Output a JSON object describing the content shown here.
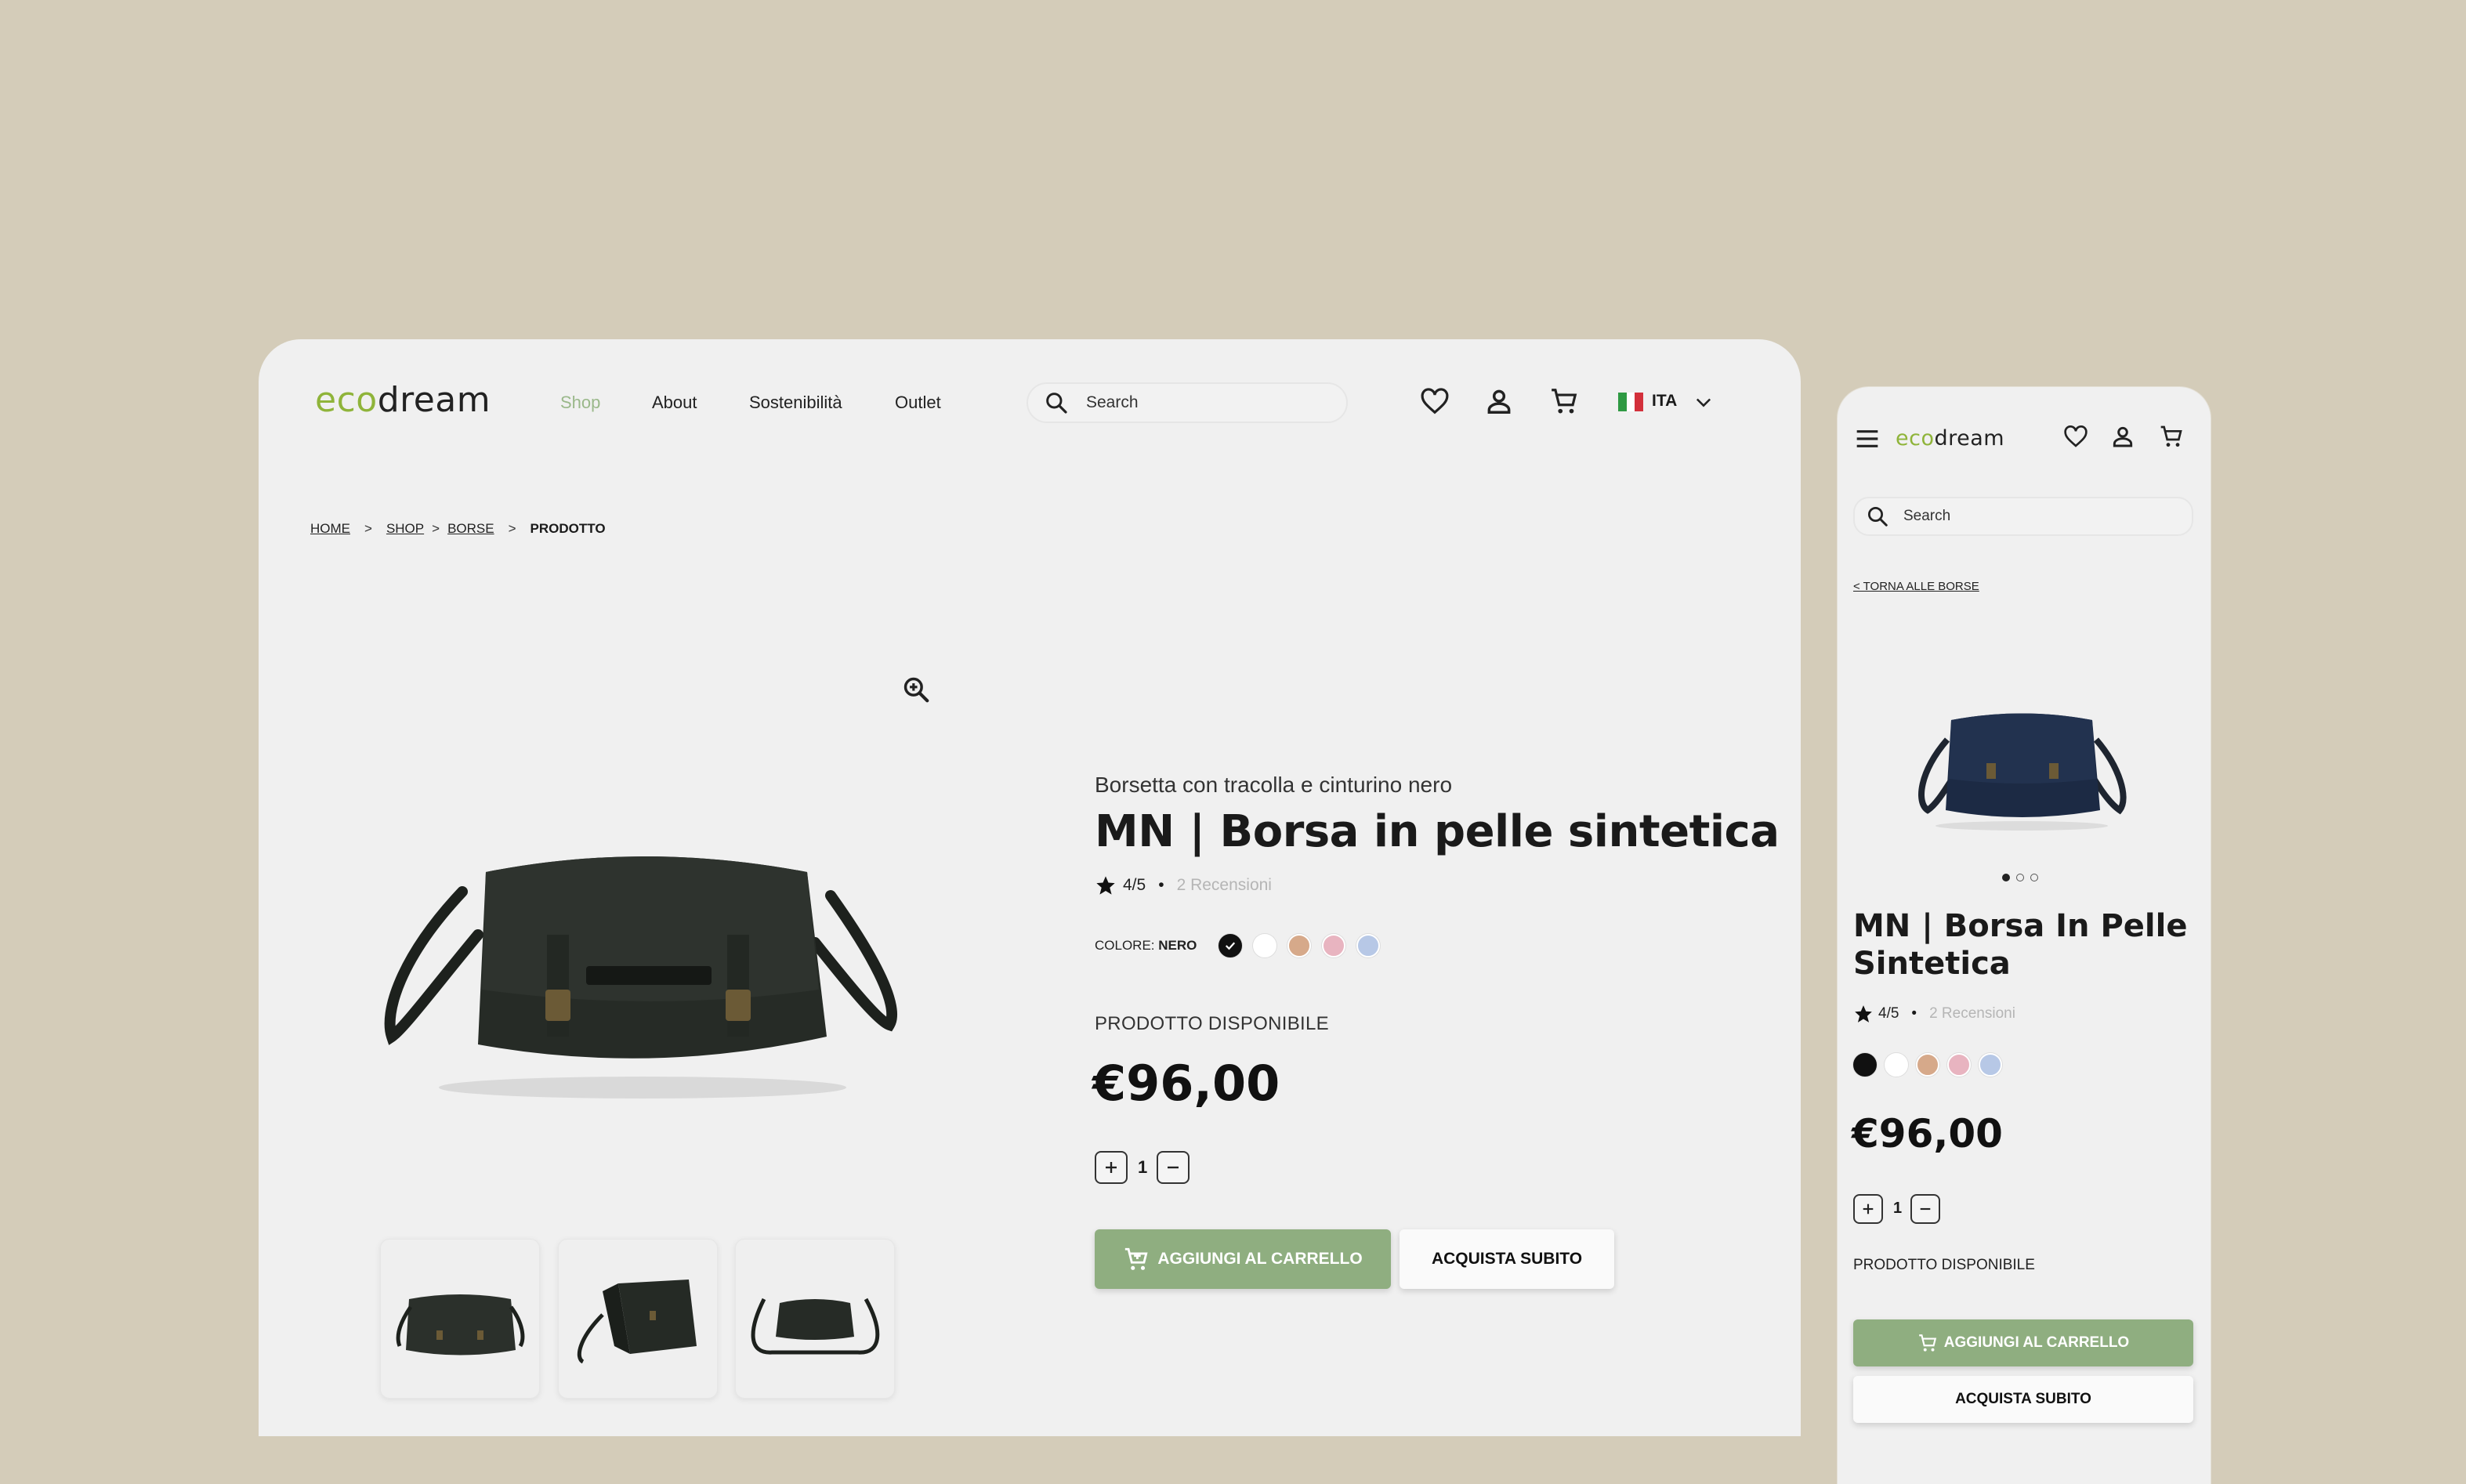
{
  "brand": {
    "eco": "eco",
    "dream": "dream"
  },
  "nav": {
    "items": [
      "Shop",
      "About",
      "Sostenibilità",
      "Outlet"
    ],
    "active": "Shop"
  },
  "search": {
    "placeholder": "Search"
  },
  "language": {
    "code": "ITA"
  },
  "breadcrumb": {
    "home": "HOME",
    "shop": "SHOP",
    "bags": "BORSE",
    "current": "PRODOTTO",
    "separator": ">"
  },
  "product": {
    "subtitle": "Borsetta con tracolla e cinturino nero",
    "title": "MN | Borsa in pelle sintetica",
    "mobile_title": "MN | Borsa In Pelle Sintetica",
    "rating": "4/5",
    "rating_dot": "•",
    "reviews": "2 Recensioni",
    "color_label": "COLORE:",
    "color_value": "NERO",
    "colors": [
      "#111111",
      "#ffffff",
      "#d6a98a",
      "#e8b4c0",
      "#b7c8e6"
    ],
    "availability": "PRODOTTO DISPONIBILE",
    "price": "€96,00",
    "quantity": "1"
  },
  "actions": {
    "add_to_cart": "AGGIUNGI AL CARRELLO",
    "buy_now": "ACQUISTA SUBITO"
  },
  "mobile": {
    "back_link": "< TORNA ALLE BORSE",
    "carousel_active": 1,
    "carousel_count": 3
  },
  "theme": {
    "accent": "#8fae80",
    "brand_green": "#8fb43a",
    "background": "#d4ccb9",
    "surface": "#f0f0f0"
  }
}
